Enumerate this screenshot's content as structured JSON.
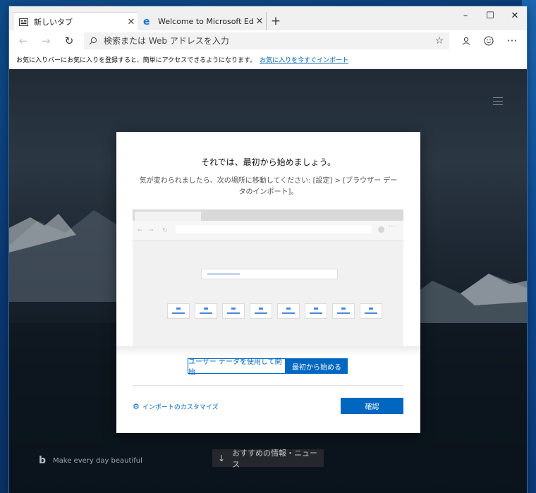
{
  "tabs": [
    {
      "title": "新しいタブ",
      "icon": "new-tab-page-icon",
      "active": true
    },
    {
      "title": "Welcome to Microsoft Edge Dev",
      "icon": "edge-logo-icon",
      "active": false
    }
  ],
  "window_controls": {
    "minimize": "–",
    "maximize": "☐",
    "close": "✕"
  },
  "toolbar": {
    "back": "←",
    "forward": "→",
    "refresh": "↻",
    "address_placeholder": "検索または Web アドレスを入力",
    "favorite_star": "☆",
    "profile_icon": "person-icon",
    "feedback_icon": "smiley-icon",
    "more": "···"
  },
  "favorites_bar": {
    "message": "お気に入りバーにお気に入りを登録すると、簡単にアクセスできるようになります。",
    "import_link": "お気に入りを今すぐインポート"
  },
  "new_tab_page": {
    "brand_text": "Make every day beautiful",
    "news_button": "おすすめの情報・ニュース"
  },
  "dialog": {
    "title": "それでは、最初から始めましょう。",
    "description": "気が変わられましたら、次の場所に移動してください: [設定] > [ブラウザー データのインポート]。",
    "option_import": "ユーザー データを使用して開始",
    "option_fresh": "最初から始める",
    "selected_option": "最初から始める",
    "customize_link": "インポートのカスタマイズ",
    "confirm_button": "確認",
    "accent_color": "#0067c0"
  }
}
